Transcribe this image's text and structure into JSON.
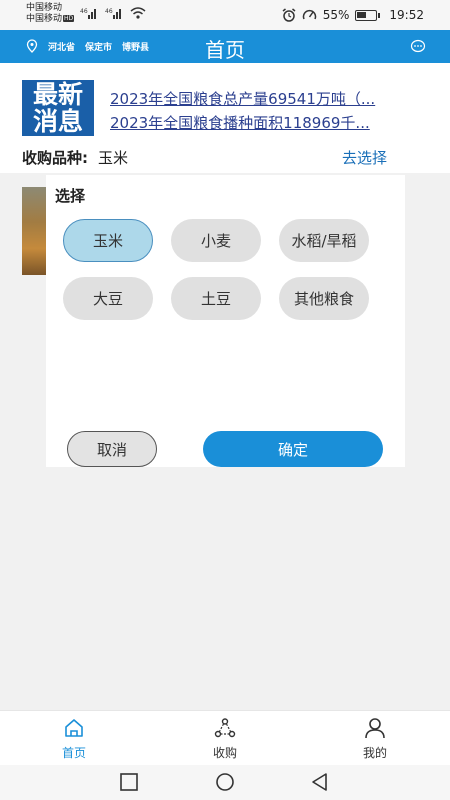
{
  "status_bar": {
    "carrier1": "中国移动",
    "carrier2": "中国移动",
    "hd": "HD",
    "sig1": "⁴⁶ᵢₗ",
    "sig2": "⁴⁶ᵢₗ",
    "battery": "55%",
    "battery_level": 0.55,
    "time": "19:52"
  },
  "header": {
    "province": "河北省",
    "city": "保定市",
    "county": "博野县",
    "title": "首页"
  },
  "news": {
    "logo_line1": "最新",
    "logo_line2": "消息",
    "items": [
      "2023年全国粮食总产量69541万吨（...",
      "2023年全国粮食播种面积118969千..."
    ]
  },
  "purchase": {
    "label": "收购品种:",
    "value": "玉米",
    "select_link": "去选择"
  },
  "modal": {
    "title": "选择",
    "options": [
      "玉米",
      "小麦",
      "水稻/旱稻",
      "大豆",
      "土豆",
      "其他粮食"
    ],
    "selected": "玉米",
    "cancel": "取消",
    "confirm": "确定"
  },
  "tabbar": {
    "home": "首页",
    "purchase": "收购",
    "mine": "我的"
  },
  "colors": {
    "primary": "#1a8fd8",
    "selected_bg": "#add8ea",
    "news_link": "#2b3f8f"
  }
}
